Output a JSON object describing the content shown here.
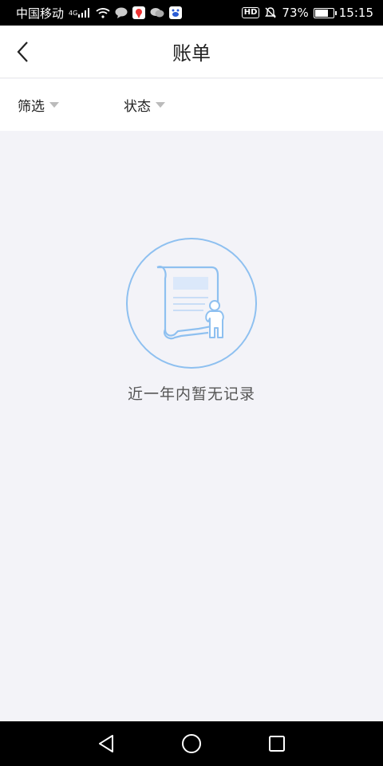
{
  "status_bar": {
    "carrier": "中国移动",
    "network": "4G",
    "battery_percent": "73%",
    "battery_level": 0.73,
    "time": "15:15",
    "hd_label": "HD"
  },
  "header": {
    "title": "账单"
  },
  "filters": [
    {
      "label": "筛选"
    },
    {
      "label": "状态"
    }
  ],
  "empty_state": {
    "message": "近一年内暂无记录"
  },
  "colors": {
    "accent_blue": "#8ec0f0",
    "page_bg": "#f3f3f8"
  }
}
